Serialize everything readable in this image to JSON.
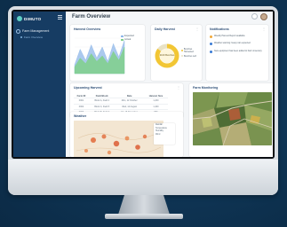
{
  "app": {
    "brand": "DIMUTO",
    "page_title": "Farm Overview"
  },
  "sidebar": {
    "group_label": "Farm Management",
    "items": [
      {
        "label": "Farm Overview",
        "active": true
      }
    ]
  },
  "cards": {
    "harvest_overview": {
      "title": "Harvest Overview",
      "legend": [
        "Expected",
        "Actual"
      ]
    },
    "daily_harvest": {
      "title": "Daily Harvest",
      "center_value": "2100 Bunches",
      "legend": [
        "Bunches Harvested",
        "Bunches Left"
      ]
    },
    "notifications": {
      "title": "Notifications",
      "items": [
        {
          "text": "Weekly Harvest Report available",
          "color": "#f2a93b"
        },
        {
          "text": "Weather warning: heavy rain expected",
          "color": "#3a7bd5"
        },
        {
          "text": "New equipment has been added to Farm inventory",
          "color": "#3a7bd5"
        }
      ]
    },
    "upcoming_harvest": {
      "title": "Upcoming Harvest",
      "columns": [
        "Farm ID",
        "Field Block",
        "Date",
        "Harvest Size"
      ],
      "rows": [
        [
          "F001",
          "Block A, Field 2",
          "Mon, 12 October",
          "1,200"
        ],
        [
          "F002",
          "Block C, Field 5",
          "Wed, 14 August",
          "1,400"
        ],
        [
          "F003",
          "Block B, Field 3",
          "Fri, 16 November",
          "950"
        ]
      ],
      "pager": "Prev  1  2  3  Next"
    },
    "weather": {
      "title": "Weather",
      "options": [
        "Rainfall",
        "Temperature",
        "Humidity",
        "Wind"
      ]
    },
    "farm_monitoring": {
      "title": "Farm Monitoring"
    }
  },
  "icons": {
    "menu": "hamburger-icon",
    "search": "search-icon",
    "more": "more-icon"
  },
  "colors": {
    "sidebar": "#163c63",
    "accent_teal": "#5fd0c5",
    "chart_green": "#7fd08a",
    "chart_blue": "#8fb7e8",
    "donut_yellow": "#f2c634",
    "donut_grey": "#e9e2c5"
  },
  "chart_data": [
    {
      "type": "area",
      "title": "Harvest Overview",
      "series": [
        {
          "name": "Expected",
          "values": [
            8,
            22,
            12,
            26,
            14,
            24,
            11,
            27,
            15,
            30
          ]
        },
        {
          "name": "Actual",
          "values": [
            6,
            14,
            9,
            18,
            11,
            16,
            9,
            20,
            12,
            24
          ]
        }
      ]
    },
    {
      "type": "pie",
      "title": "Daily Harvest",
      "categories": [
        "Bunches Harvested",
        "Bunches Left"
      ],
      "values": [
        85,
        15
      ]
    }
  ]
}
